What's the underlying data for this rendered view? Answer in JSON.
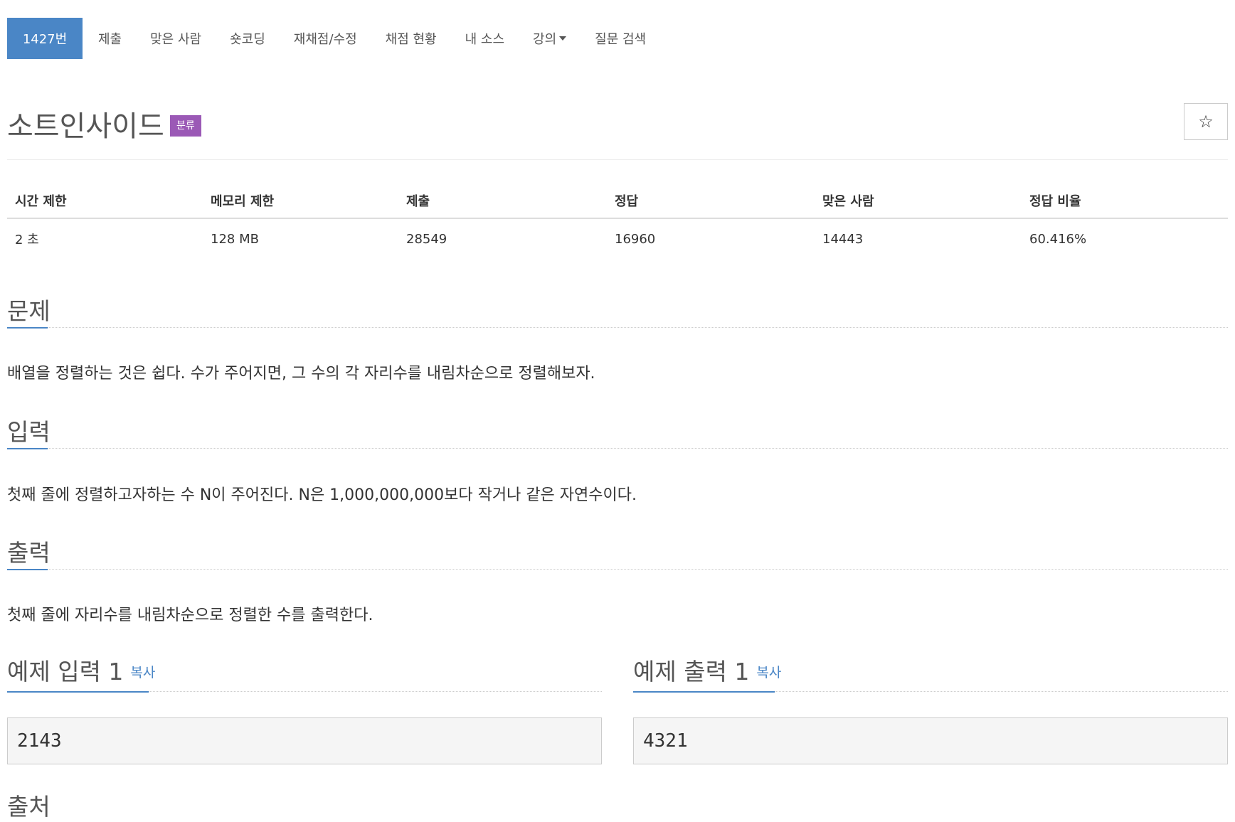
{
  "nav": {
    "items": [
      {
        "label": "1427번",
        "active": true
      },
      {
        "label": "제출"
      },
      {
        "label": "맞은 사람"
      },
      {
        "label": "숏코딩"
      },
      {
        "label": "재채점/수정"
      },
      {
        "label": "채점 현황"
      },
      {
        "label": "내 소스"
      },
      {
        "label": "강의",
        "dropdown": true
      },
      {
        "label": "질문 검색"
      }
    ]
  },
  "problem": {
    "title": "소트인사이드",
    "badge": "분류",
    "star": "☆"
  },
  "info": {
    "headers": [
      "시간 제한",
      "메모리 제한",
      "제출",
      "정답",
      "맞은 사람",
      "정답 비율"
    ],
    "values": [
      "2 초",
      "128 MB",
      "28549",
      "16960",
      "14443",
      "60.416%"
    ]
  },
  "sections": {
    "problem": {
      "title": "문제",
      "text": "배열을 정렬하는 것은 쉽다. 수가 주어지면, 그 수의 각 자리수를 내림차순으로 정렬해보자."
    },
    "input": {
      "title": "입력",
      "text": "첫째 줄에 정렬하고자하는 수 N이 주어진다. N은 1,000,000,000보다 작거나 같은 자연수이다."
    },
    "output": {
      "title": "출력",
      "text": "첫째 줄에 자리수를 내림차순으로 정렬한 수를 출력한다."
    }
  },
  "samples": {
    "input": {
      "title": "예제 입력 1",
      "copy": "복사",
      "value": "2143"
    },
    "output": {
      "title": "예제 출력 1",
      "copy": "복사",
      "value": "4321"
    }
  },
  "source_heading": "출처",
  "colors": {
    "accent": "#4a86c6",
    "badge": "#9b59b6"
  }
}
